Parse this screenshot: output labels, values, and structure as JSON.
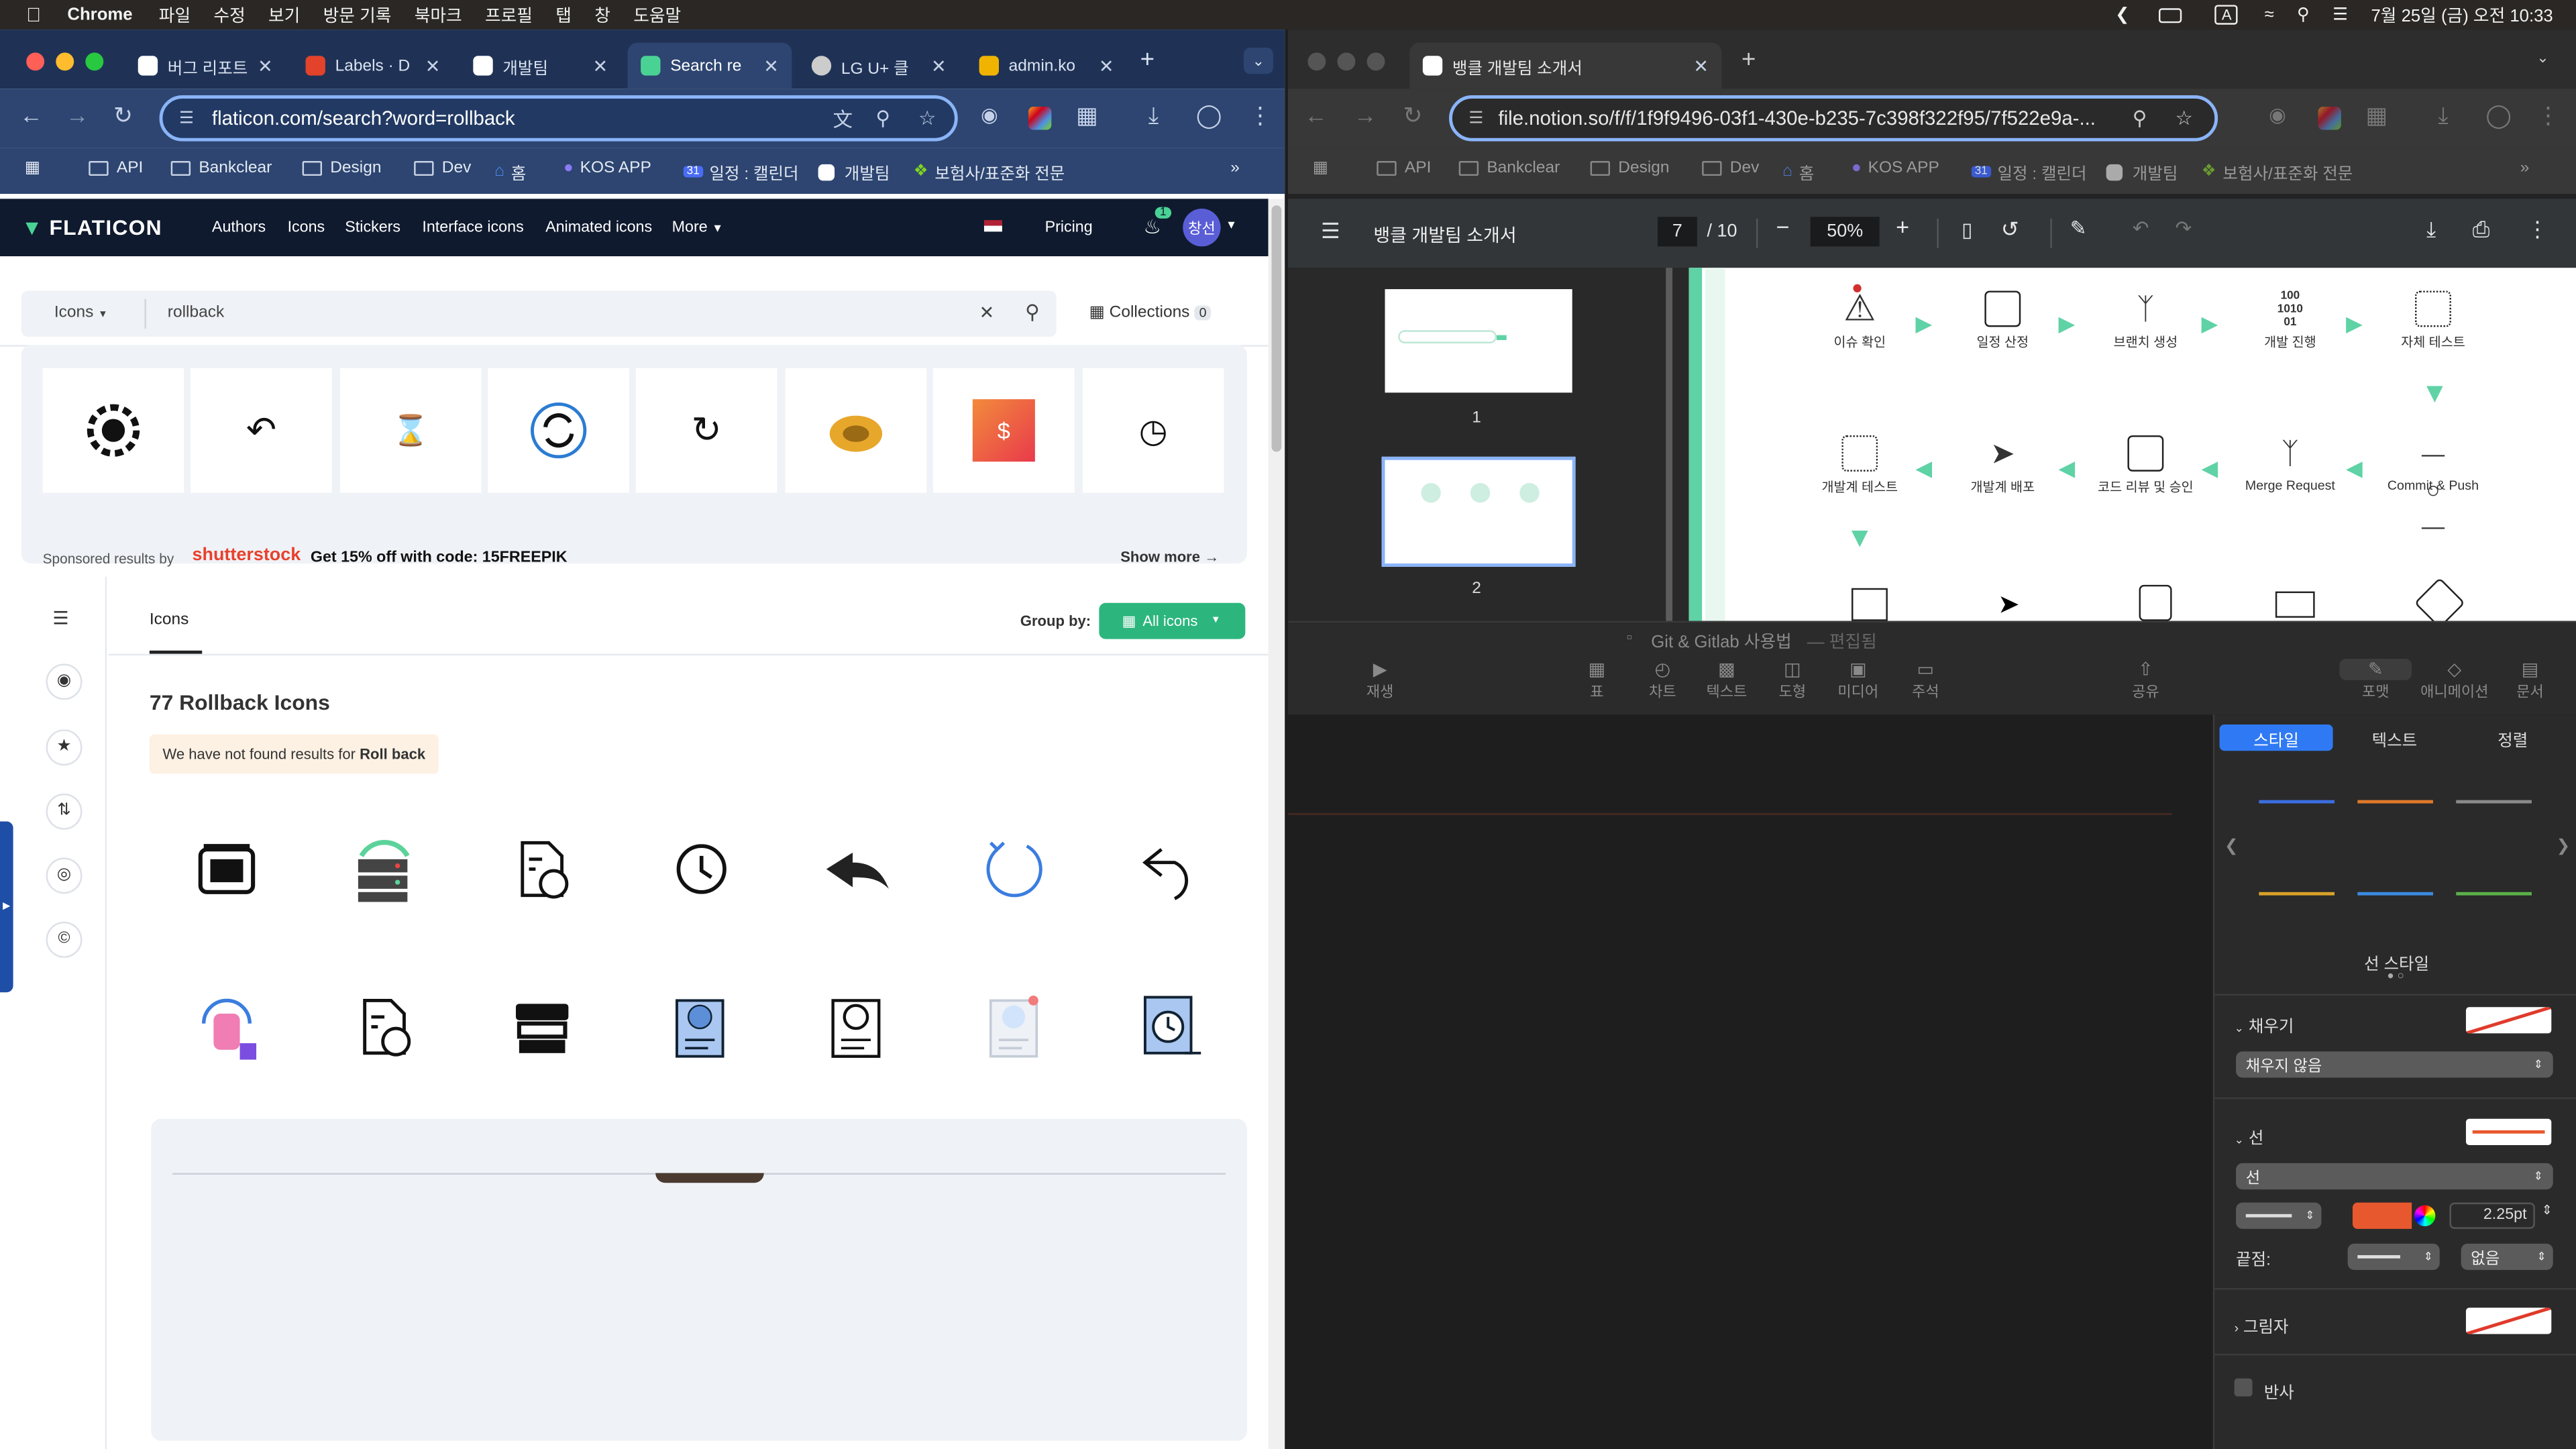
{
  "menubar": {
    "app": "Chrome",
    "items": [
      "파일",
      "수정",
      "보기",
      "방문 기록",
      "북마크",
      "프로필",
      "탭",
      "창",
      "도움말"
    ],
    "clock": "7월 25일 (금) 오전 10:33",
    "input_mode": "A"
  },
  "left_browser": {
    "tabs": [
      {
        "label": "버그 리포트",
        "icon": "notion-icon",
        "color": "#ffffff"
      },
      {
        "label": "Labels · D",
        "icon": "gitlab-icon",
        "color": "#e2432a"
      },
      {
        "label": "개발팀",
        "icon": "notion-icon",
        "color": "#ffffff"
      },
      {
        "label": "Search re",
        "icon": "flaticon-icon",
        "color": "#4ad295"
      },
      {
        "label": "LG U+ 클",
        "icon": "globe-icon",
        "color": "#cccccc"
      },
      {
        "label": "admin.ko",
        "icon": "admin-icon",
        "color": "#f0b400"
      }
    ],
    "url": "flaticon.com/search?word=rollback",
    "bookmarks": [
      "API",
      "Bankclear",
      "Design",
      "Dev",
      "홈",
      "KOS APP",
      "일정 : 캘린더",
      "개발팀",
      "보험사/표준화 전문"
    ],
    "overflow": "»"
  },
  "flaticon": {
    "logo": "FLATICON",
    "nav": [
      "Authors",
      "Icons",
      "Stickers",
      "Interface icons",
      "Animated icons",
      "More"
    ],
    "pricing": "Pricing",
    "notif_count": "1",
    "avatar": "창선",
    "search": {
      "type": "Icons",
      "query": "rollback"
    },
    "collections": "Collections",
    "collections_count": "0",
    "sponsored": {
      "label": "Sponsored results by",
      "brand": "shutterstock",
      "promo": "Get 15% off with code: 15FREEPIK",
      "show_more": "Show more"
    },
    "tab_icons": "Icons",
    "group_by": "Group by:",
    "group_value": "All icons",
    "results_title": "77 Rollback Icons",
    "notice_prefix": "We have not found results for",
    "notice_term": "Roll back",
    "icons_row1": [
      "server-rollback-icon",
      "database-sync-icon",
      "code-file-refresh-icon",
      "history-clock-icon",
      "back-arrow-filled-icon",
      "circular-arrow-icon",
      "undo-arrow-icon"
    ],
    "icons_row2": [
      "hand-rollback-icon",
      "code-file-refresh-icon",
      "server-rollback-bold-icon",
      "code-document-blue-icon",
      "code-document-icon",
      "code-document-light-icon",
      "backup-clock-blue-icon"
    ]
  },
  "right_browser": {
    "tab": "뱅클 개발팀 소개서",
    "url": "file.notion.so/f/f/1f9f9496-03f1-430e-b235-7c398f322f95/7f522e9a-...",
    "bookmarks": [
      "API",
      "Bankclear",
      "Design",
      "Dev",
      "홈",
      "KOS APP",
      "일정 : 캘린더",
      "개발팀",
      "보험사/표준화 전문"
    ],
    "pdf": {
      "title": "뱅클 개발팀 소개서",
      "page": "7",
      "total": "/ 10",
      "zoom": "50%",
      "thumbs": [
        "1",
        "2"
      ],
      "flow_row1": [
        "이슈 확인",
        "일정 산정",
        "브랜치 생성",
        "개발 진행",
        "자체 테스트"
      ],
      "flow_row2": [
        "개발계 테스트",
        "개발계 배포",
        "코드 리뷰 및 승인",
        "Merge Request",
        "Commit & Push"
      ]
    }
  },
  "keynote": {
    "title": "Git & Gitlab 사용법",
    "title_suffix": "— 편집됨",
    "toolbar": [
      "재생",
      "표",
      "차트",
      "텍스트",
      "도형",
      "미디어",
      "주석",
      "공유",
      "포맷",
      "애니메이션",
      "문서"
    ],
    "panel_tabs": [
      "스타일",
      "텍스트",
      "정렬"
    ],
    "line_style_label": "선 스타일",
    "fill_label": "채우기",
    "fill_value": "채우지 않음",
    "stroke_label": "선",
    "stroke_value": "선",
    "stroke_width": "2.25pt",
    "endpoint_label": "끝점:",
    "endpoint_value": "없음",
    "shadow_label": "그림자",
    "reflection_label": "반사",
    "accent": "#e8582e"
  }
}
